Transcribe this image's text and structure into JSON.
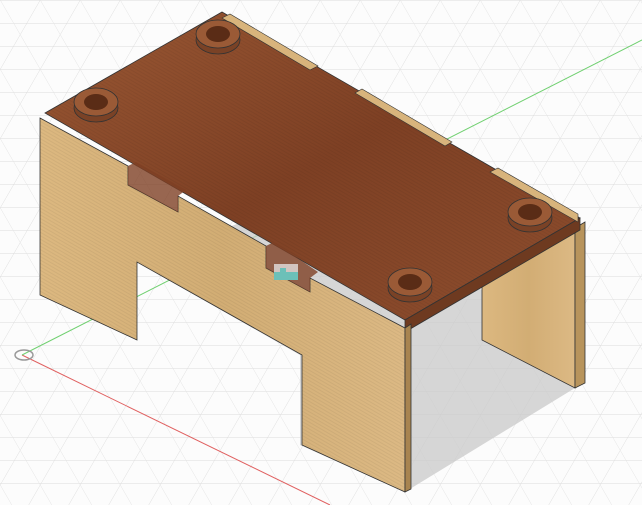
{
  "viewport": {
    "kind": "3d-model-canvas",
    "model": "wooden-box-table-with-four-pegs",
    "colors": {
      "background": "#fcfcfc",
      "grid": "#dcdcdc",
      "x_axis": "#e06060",
      "y_axis": "#70d070",
      "top_wood": "#8a4a2c",
      "panel_wood": "#d8b47c",
      "shadow": "#c8c8c8"
    },
    "origin_icon": "origin-marker-icon",
    "selection_marker_icon": "joint-marker-icon"
  }
}
